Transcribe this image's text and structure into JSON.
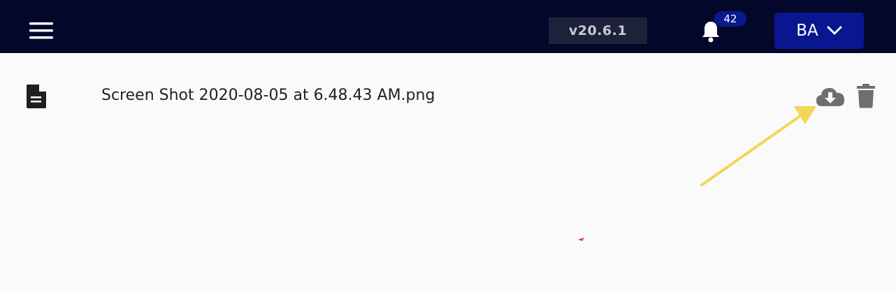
{
  "header": {
    "version": "v20.6.1",
    "notification_count": "42",
    "user_initials": "BA"
  },
  "file": {
    "name": "Screen Shot 2020-08-05 at 6.48.43 AM.png"
  },
  "icons": {
    "menu": "hamburger-menu-icon",
    "bell": "bell-icon",
    "chevron": "chevron-down-icon",
    "file": "document-icon",
    "download": "cloud-download-icon",
    "delete": "trash-icon"
  },
  "colors": {
    "header_bg": "#03072a",
    "version_bg": "#1d2139",
    "accent": "#0a1690",
    "icon_gray": "#6f6f6f",
    "annotation_arrow": "#f4d55a"
  }
}
